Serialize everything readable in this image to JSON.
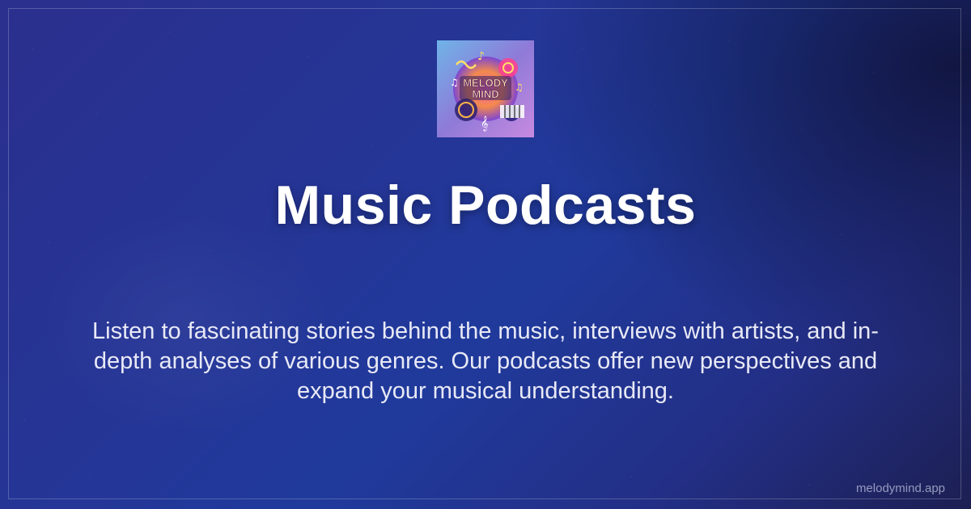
{
  "logo": {
    "text_line1": "MELODY",
    "text_line2": "MIND"
  },
  "title": "Music Podcasts",
  "description": "Listen to fascinating stories behind the music, interviews with artists, and in-depth analyses of various genres. Our podcasts offer new perspectives and expand your musical understanding.",
  "footer": {
    "domain": "melodymind.app"
  },
  "colors": {
    "background_start": "#2b2f8d",
    "background_mid": "#203a9c",
    "background_end": "#1c1f52",
    "title": "#ffffff",
    "description": "#e8e9f6",
    "footer": "#c8cce6"
  }
}
